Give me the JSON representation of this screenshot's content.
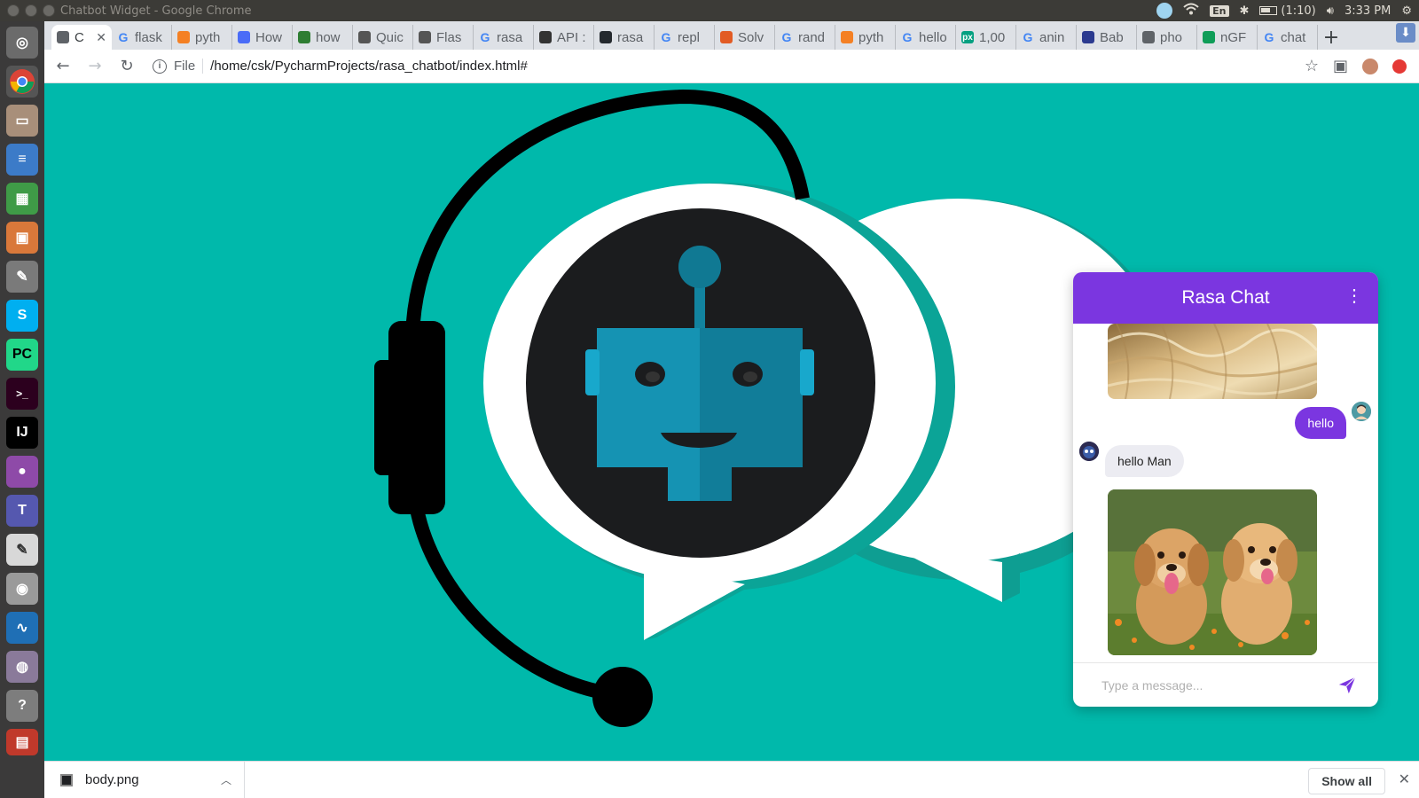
{
  "window": {
    "title": "Chatbot Widget - Google Chrome"
  },
  "tray": {
    "lang": "En",
    "battery": "(1:10)",
    "clock": "3:33 PM"
  },
  "tabs": [
    {
      "label": "C",
      "fav": "page",
      "color": "#5f6368"
    },
    {
      "label": "flask",
      "fav": "G",
      "color": "#4285f4"
    },
    {
      "label": "pyth",
      "fav": "so",
      "color": "#f48024"
    },
    {
      "label": "How",
      "fav": "loop",
      "color": "#4a6cf7"
    },
    {
      "label": "how",
      "fav": "y",
      "color": "#2e7d32"
    },
    {
      "label": "Quic",
      "fav": "doc",
      "color": "#555"
    },
    {
      "label": "Flas",
      "fav": "doc",
      "color": "#555"
    },
    {
      "label": "rasa",
      "fav": "G",
      "color": "#4285f4"
    },
    {
      "label": "API :",
      "fav": "doc",
      "color": "#333"
    },
    {
      "label": "rasa",
      "fav": "gh",
      "color": "#24292e"
    },
    {
      "label": "repl",
      "fav": "G",
      "color": "#4285f4"
    },
    {
      "label": "Solv",
      "fav": "rss",
      "color": "#e25b24"
    },
    {
      "label": "rand",
      "fav": "G",
      "color": "#4285f4"
    },
    {
      "label": "pyth",
      "fav": "so",
      "color": "#f48024"
    },
    {
      "label": "hello",
      "fav": "G",
      "color": "#4285f4"
    },
    {
      "label": "1,00",
      "fav": "px",
      "color": "#05a081"
    },
    {
      "label": "anin",
      "fav": "G",
      "color": "#4285f4"
    },
    {
      "label": "Bab",
      "fav": "C",
      "color": "#2b3a8f"
    },
    {
      "label": "pho",
      "fav": "globe",
      "color": "#5f6368"
    },
    {
      "label": "nGF",
      "fav": "img",
      "color": "#0f9d58"
    },
    {
      "label": "chat",
      "fav": "G",
      "color": "#4285f4"
    }
  ],
  "omnibox": {
    "scheme": "File",
    "url": "/home/csk/PycharmProjects/rasa_chatbot/index.html#"
  },
  "chat": {
    "title": "Rasa Chat",
    "messages": [
      {
        "type": "image",
        "subject": "fluffy golden fur"
      },
      {
        "type": "user",
        "text": "hello"
      },
      {
        "type": "bot",
        "text": "hello Man"
      },
      {
        "type": "image",
        "subject": "two golden retriever puppies in flowers"
      }
    ],
    "input_placeholder": "Type a message..."
  },
  "downloads": {
    "file": "body.png",
    "show_all": "Show all"
  },
  "colors": {
    "page_bg": "#00b9ab",
    "chat_accent": "#7b36e0",
    "robot_face": "#12839f"
  }
}
